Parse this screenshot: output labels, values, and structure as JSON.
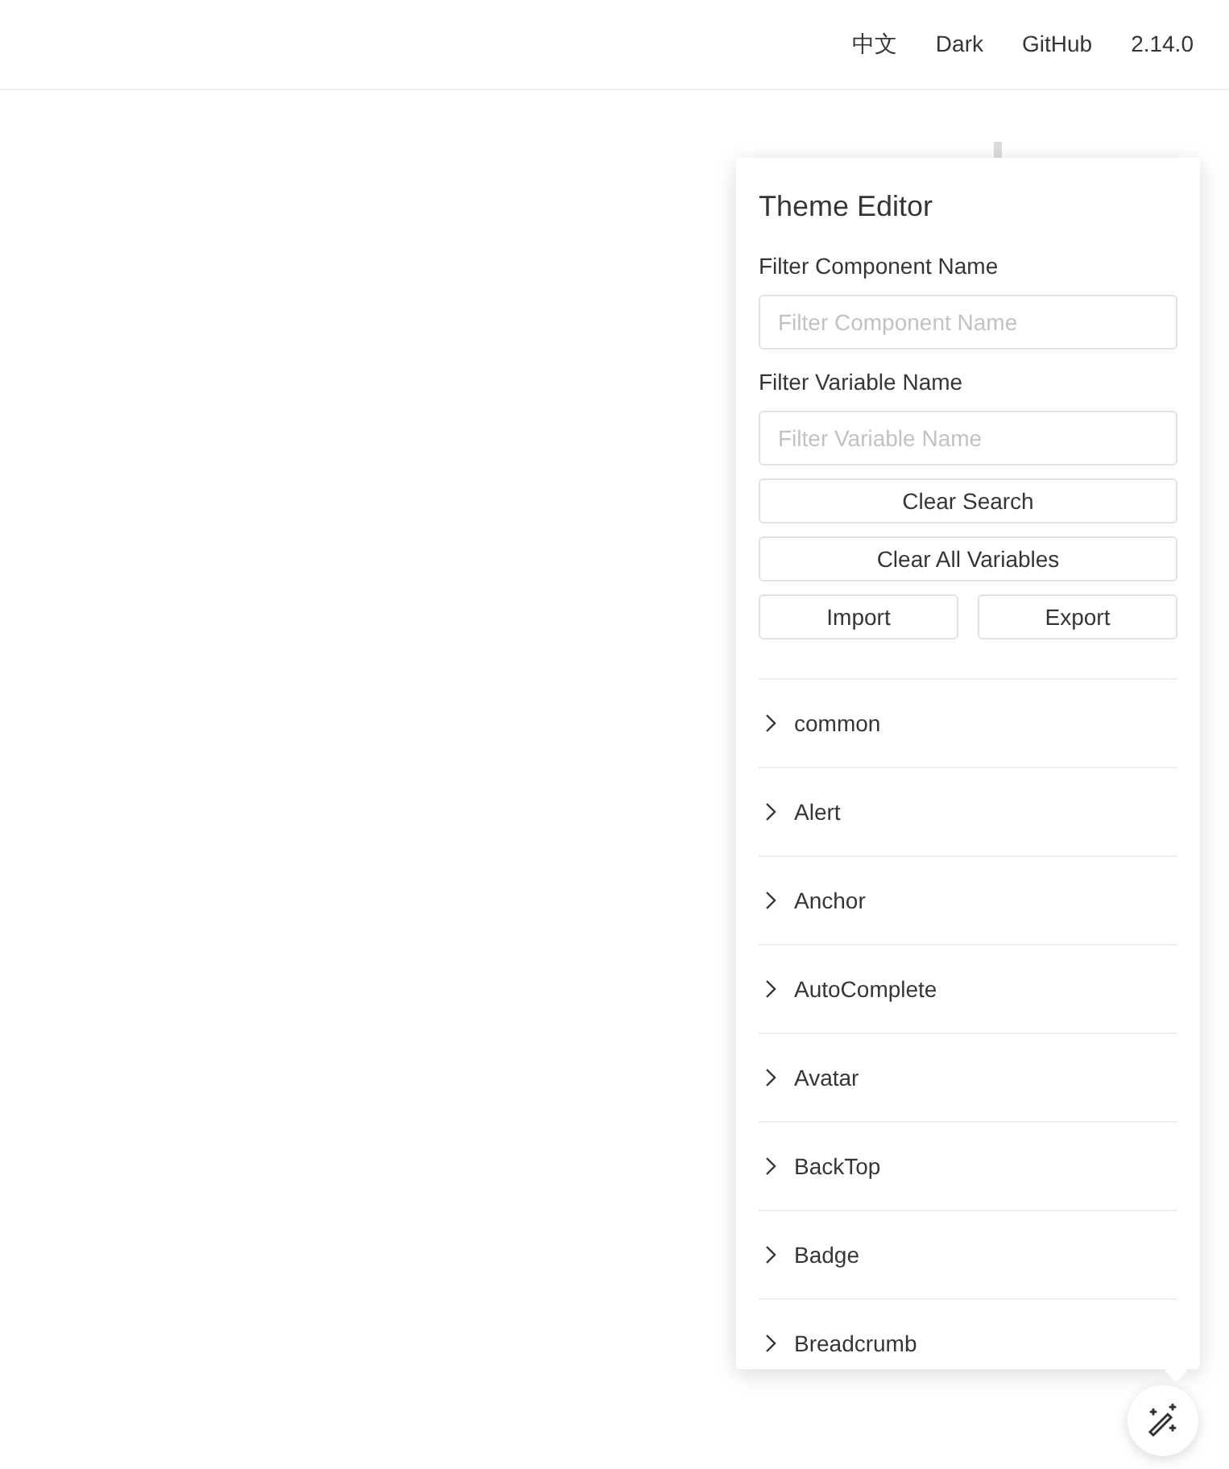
{
  "nav": [
    {
      "label": "中文"
    },
    {
      "label": "Dark"
    },
    {
      "label": "GitHub"
    },
    {
      "label": "2.14.0"
    }
  ],
  "theme_editor": {
    "title": "Theme Editor",
    "component_filter": {
      "label": "Filter Component Name",
      "placeholder": "Filter Component Name"
    },
    "variable_filter": {
      "label": "Filter Variable Name",
      "placeholder": "Filter Variable Name"
    },
    "buttons": [
      {
        "label": "Clear Search"
      },
      {
        "label": "Clear All Variables"
      }
    ],
    "row_buttons": [
      {
        "label": "Import"
      },
      {
        "label": "Export"
      }
    ],
    "components": [
      {
        "label": "common",
        "expanded": false
      },
      {
        "label": "Alert",
        "expanded": false
      },
      {
        "label": "Anchor",
        "expanded": false
      },
      {
        "label": "AutoComplete",
        "expanded": false
      },
      {
        "label": "Avatar",
        "expanded": false
      },
      {
        "label": "BackTop",
        "expanded": false
      },
      {
        "label": "Badge",
        "expanded": false
      },
      {
        "label": "Breadcrumb",
        "expanded": false
      }
    ]
  }
}
